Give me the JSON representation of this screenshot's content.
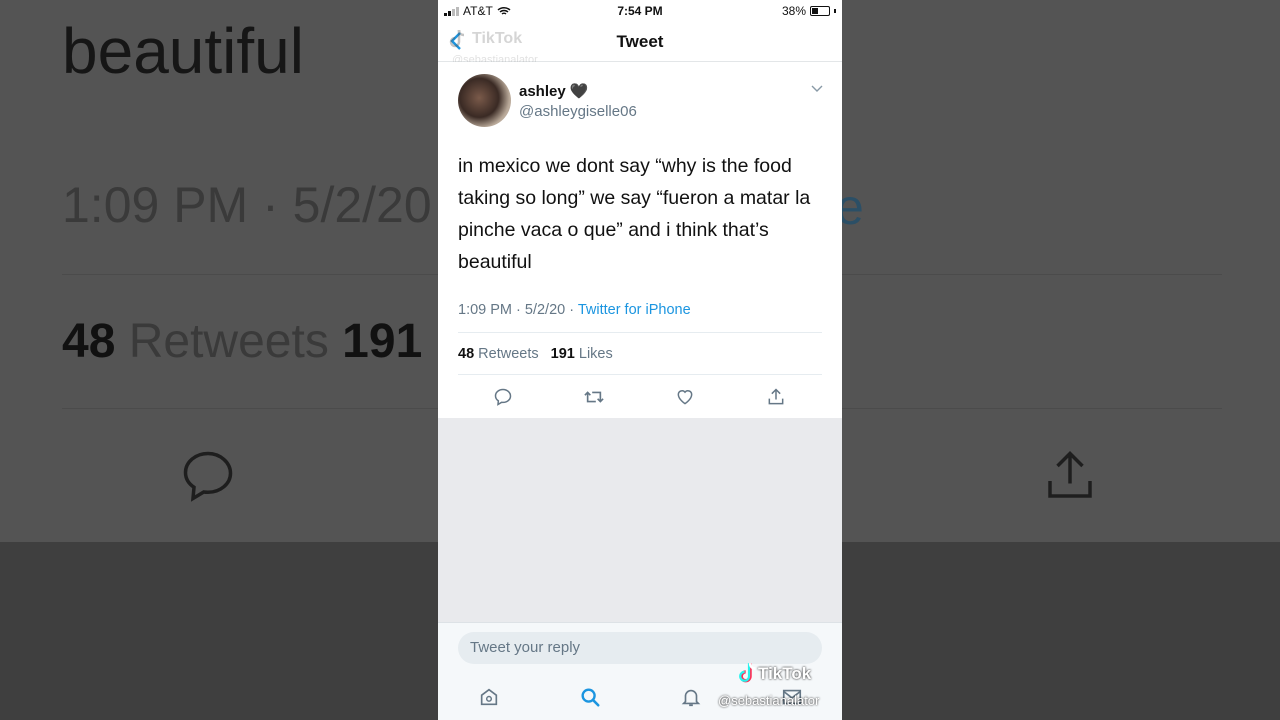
{
  "background": {
    "word": "beautiful",
    "time": "1:09 PM · 5/2/20",
    "time_accent": "e",
    "retweet_count": "48",
    "retweet_label": "Retweets",
    "likes_partial": "191"
  },
  "status_bar": {
    "carrier": "AT&T",
    "time": "7:54 PM",
    "battery": "38%"
  },
  "nav": {
    "title": "Tweet"
  },
  "watermark": {
    "name": "TikTok",
    "handle": "@sebastianalator"
  },
  "tweet": {
    "display_name": "ashley 🖤",
    "handle": "@ashleygiselle06",
    "text": "in mexico we dont say “why is the food taking so long” we say “fueron a matar la pinche vaca o que” and i think that’s beautiful",
    "time": "1:09 PM · 5/2/20 · ",
    "source": "Twitter for iPhone",
    "retweets": "48",
    "retweets_label": "Retweets",
    "likes": "191",
    "likes_label": "Likes"
  },
  "reply": {
    "placeholder": "Tweet your reply"
  },
  "icons": {
    "reply": "speech-bubble-icon",
    "retweet": "retweet-icon",
    "like": "heart-icon",
    "share": "share-icon",
    "home": "home-icon",
    "search": "search-icon",
    "notifications": "bell-icon",
    "messages": "envelope-icon"
  },
  "colors": {
    "accent": "#1b95e0",
    "muted": "#657786"
  }
}
